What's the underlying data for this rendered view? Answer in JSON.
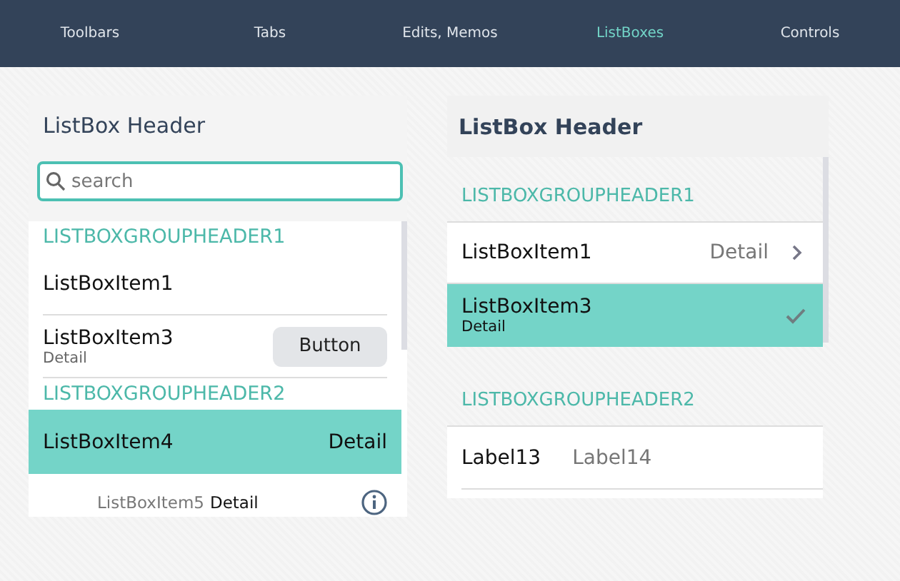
{
  "nav": {
    "tabs": [
      {
        "label": "Toolbars",
        "selected": false
      },
      {
        "label": "Tabs",
        "selected": false
      },
      {
        "label": "Edits, Memos",
        "selected": false
      },
      {
        "label": "ListBoxes",
        "selected": true
      },
      {
        "label": "Controls",
        "selected": false
      }
    ]
  },
  "left": {
    "header": "ListBox Header",
    "search": {
      "placeholder": "search"
    },
    "rows": [
      {
        "kind": "group",
        "text": "LISTBOXGROUPHEADER1"
      },
      {
        "kind": "item",
        "text": "ListBoxItem1",
        "selected": false
      },
      {
        "kind": "button",
        "text": "ListBoxItem3",
        "detail": "Detail",
        "button": "Button",
        "selected": false
      },
      {
        "kind": "group",
        "text": "LISTBOXGROUPHEADER2"
      },
      {
        "kind": "detail",
        "text": "ListBoxItem4",
        "detail": "Detail",
        "selected": true
      },
      {
        "kind": "info",
        "text": "ListBoxItem5",
        "detail": "Detail",
        "selected": false
      }
    ]
  },
  "right": {
    "header": "ListBox Header",
    "rows": [
      {
        "kind": "group",
        "text": "LISTBOXGROUPHEADER1"
      },
      {
        "kind": "chevron",
        "text": "ListBoxItem1",
        "detail": "Detail",
        "selected": false
      },
      {
        "kind": "check",
        "text": "ListBoxItem3",
        "detail": "Detail",
        "selected": true,
        "checked": true
      },
      {
        "kind": "group",
        "text": "LISTBOXGROUPHEADER2"
      },
      {
        "kind": "labels",
        "text": "Label13",
        "detail": "Label14"
      }
    ]
  }
}
